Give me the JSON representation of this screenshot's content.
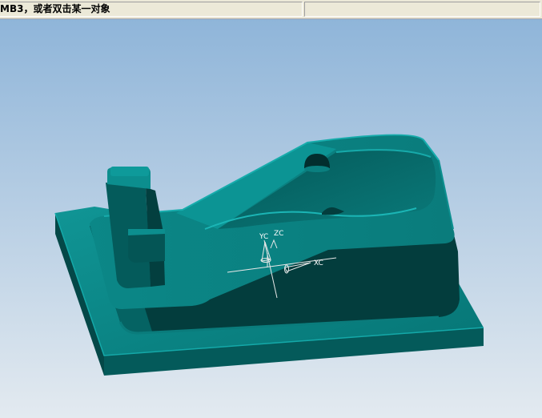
{
  "status_bar": {
    "prompt_text": "MB3，或者双击某一对象",
    "message_text": ""
  },
  "viewport": {
    "background_top": "#8fb5d9",
    "background_bottom": "#e3eaf0",
    "model_colors": {
      "top_face": "#0c8a8a",
      "top_face_light": "#1aa3a3",
      "side_dark": "#034848",
      "side_mid": "#056363",
      "rim": "#0d9b9b"
    },
    "triad": {
      "x_label": "XC",
      "y_label": "YC",
      "z_label": "ZC"
    }
  }
}
